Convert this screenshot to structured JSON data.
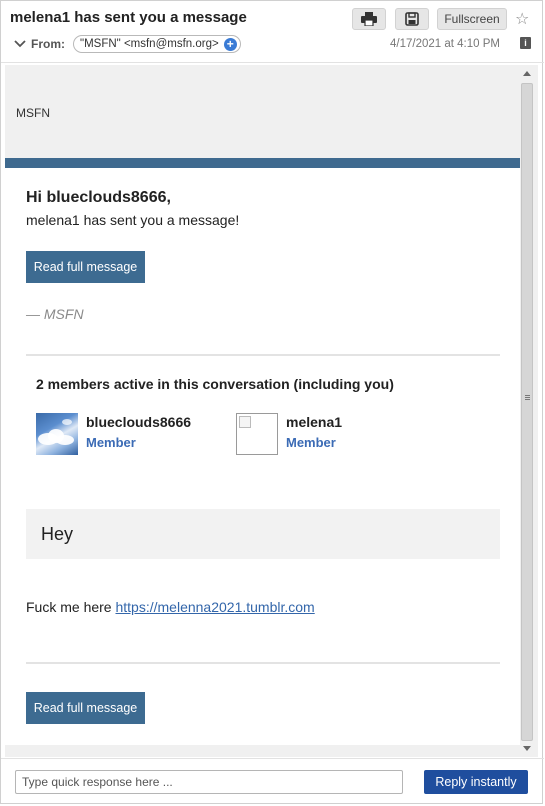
{
  "header": {
    "subject": "melena1 has sent you a message",
    "fullscreen_label": "Fullscreen",
    "from_label": "From:",
    "from_address": "\"MSFN\" <msfn@msfn.org>",
    "date": "4/17/2021 at 4:10 PM",
    "icons": [
      "print-icon",
      "save-icon",
      "star-icon",
      "chevron-down-icon",
      "add-contact-icon",
      "info-icon"
    ]
  },
  "email": {
    "brand": "MSFN",
    "greeting": "Hi blueclouds8666,",
    "intro": "melena1 has sent you a message!",
    "read_button": "Read full message",
    "signature": "— MSFN",
    "members_title": "2 members active in this conversation (including you)",
    "members": [
      {
        "name": "blueclouds8666",
        "role": "Member"
      },
      {
        "name": "melena1",
        "role": "Member"
      }
    ],
    "quote": "Hey",
    "body_text": "Fuck me here ",
    "body_link": "https://melenna2021.tumblr.com",
    "read_button_bottom": "Read full message"
  },
  "footer": {
    "reply_placeholder": "Type quick response here ...",
    "reply_button": "Reply instantly"
  },
  "colors": {
    "stripe": "#3f6a8f",
    "button": "#3d6b91",
    "member_role": "#3b6bb5",
    "reply_button": "#1f4e9e"
  }
}
